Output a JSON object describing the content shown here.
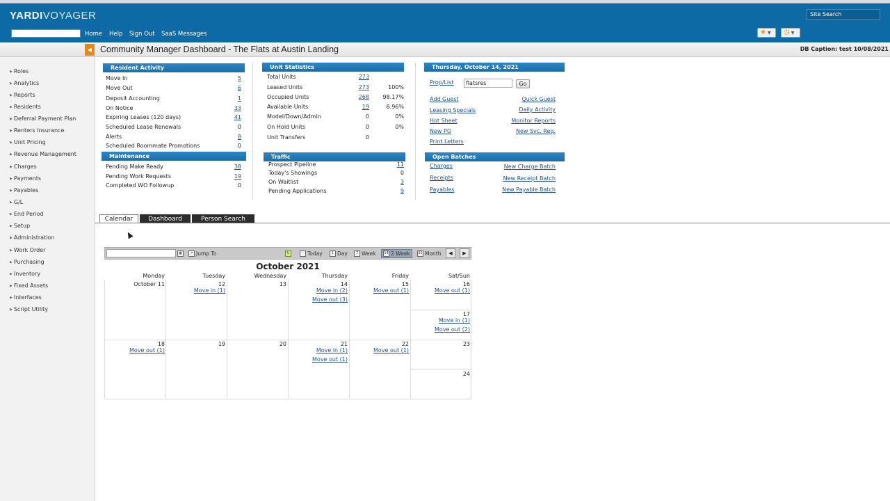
{
  "app": {
    "logo_main": "YARDI",
    "logo_sub": "VOYAGER",
    "nav": [
      "Home",
      "Help",
      "Sign Out",
      "SaaS Messages"
    ],
    "site_search_placeholder": "Site Search",
    "brand_color": "#0d6aa5"
  },
  "title": {
    "page_title": "Community Manager Dashboard - The Flats at Austin Landing",
    "db_caption": "DB Caption: test 10/08/2021"
  },
  "sidebar": {
    "items": [
      "Roles",
      "Analytics",
      "Reports",
      "Residents",
      "Deferral Payment Plan",
      "Renters Insurance",
      "Unit Pricing",
      "Revenue Management",
      "Charges",
      "Payments",
      "Payables",
      "G/L",
      "End Period",
      "Setup",
      "Administration",
      "Work Order",
      "Purchasing",
      "Inventory",
      "Fixed Assets",
      "Interfaces",
      "Script Utility"
    ]
  },
  "resident_activity": {
    "header": "Resident Activity",
    "rows": [
      {
        "label": "Move In",
        "value": "5",
        "link": true
      },
      {
        "label": "Move Out",
        "value": "6",
        "link": true
      },
      {
        "label": "Deposit Accounting",
        "value": "1",
        "link": true
      },
      {
        "label": "On Notice",
        "value": "33",
        "link": true
      },
      {
        "label": "Expiring Leases (120 days)",
        "value": "41",
        "link": true
      },
      {
        "label": "Scheduled Lease Renewals",
        "value": "0",
        "link": false
      },
      {
        "label": "Alerts",
        "value": "8",
        "link": true
      },
      {
        "label": "Scheduled Roommate Promotions",
        "value": "0",
        "link": false
      }
    ]
  },
  "maintenance": {
    "header": "Maintenance",
    "rows": [
      {
        "label": "Pending Make Ready",
        "value": "38",
        "link": true
      },
      {
        "label": "Pending Work Requests",
        "value": "19",
        "link": true
      },
      {
        "label": "Completed WO Followup",
        "value": "0",
        "link": false
      }
    ]
  },
  "unit_statistics": {
    "header": "Unit Statistics",
    "rows": [
      {
        "label": "Total Units",
        "value": "273",
        "link": true,
        "pct": ""
      },
      {
        "label": "Leased Units",
        "value": "273",
        "link": true,
        "pct": "100%"
      },
      {
        "label": "Occupied Units",
        "value": "268",
        "link": true,
        "pct": "98.17%"
      },
      {
        "label": "Available Units",
        "value": "19",
        "link": true,
        "pct": "6.96%"
      },
      {
        "label": "Model/Down/Admin",
        "value": "0",
        "link": false,
        "pct": "0%"
      },
      {
        "label": "On Hold Units",
        "value": "0",
        "link": false,
        "pct": "0%"
      },
      {
        "label": "Unit Transfers",
        "value": "0",
        "link": false,
        "pct": ""
      }
    ]
  },
  "traffic": {
    "header": "Traffic",
    "rows": [
      {
        "label": "Prospect Pipeline",
        "value": "11",
        "link": true
      },
      {
        "label": "Today's Showings",
        "value": "0",
        "link": false
      },
      {
        "label": "On Waitlist",
        "value": "3",
        "link": true
      },
      {
        "label": "Pending Applications",
        "value": "9",
        "link": true
      }
    ]
  },
  "actions": {
    "date_header": "Thursday, October 14, 2021",
    "prop_list_label": "Prop/List",
    "prop_value": "flatsres",
    "go_label": "Go",
    "left_links": [
      "Add Guest",
      "Leasing Specials",
      "Hot Sheet",
      "New PO",
      "Print Letters"
    ],
    "right_links": [
      "Quick Guest",
      "Daily Activity",
      "Monitor Reports",
      "New Svc. Req."
    ]
  },
  "open_batches": {
    "header": "Open Batches",
    "left_links": [
      "Charges",
      "Receipts",
      "Payables"
    ],
    "right_links": [
      "New Charge Batch",
      "New Receipt Batch",
      "New Payable Batch"
    ]
  },
  "tabs": [
    "Calendar",
    "Dashboard",
    "Person Search"
  ],
  "calendar": {
    "toolbar": {
      "jump_to": "Jump To",
      "today": "Today",
      "day": "Day",
      "week": "Week",
      "two_week": "2 Week",
      "month": "Month"
    },
    "month_title": "October 2021",
    "day_names": [
      "Monday",
      "Tuesday",
      "Wednesday",
      "Thursday",
      "Friday",
      "Sat/Sun"
    ],
    "week1": {
      "days": [
        "October 11",
        "12",
        "13",
        "14",
        "15",
        "16",
        "17"
      ],
      "tue_events": [
        "Move in (1)"
      ],
      "thu_events": [
        "Move in (2)",
        "Move out (3)"
      ],
      "fri_events": [
        "Move out (1)"
      ],
      "sat_events": [
        "Move out (1)"
      ],
      "sun_events": [
        "Move in (1)",
        "Move out (2)"
      ]
    },
    "week2": {
      "days": [
        "18",
        "19",
        "20",
        "21",
        "22",
        "23",
        "24"
      ],
      "mon_events": [
        "Move out (1)"
      ],
      "thu_events": [
        "Move in (1)",
        "Move out (1)"
      ],
      "fri_events": [
        "Move out (1)"
      ]
    }
  }
}
